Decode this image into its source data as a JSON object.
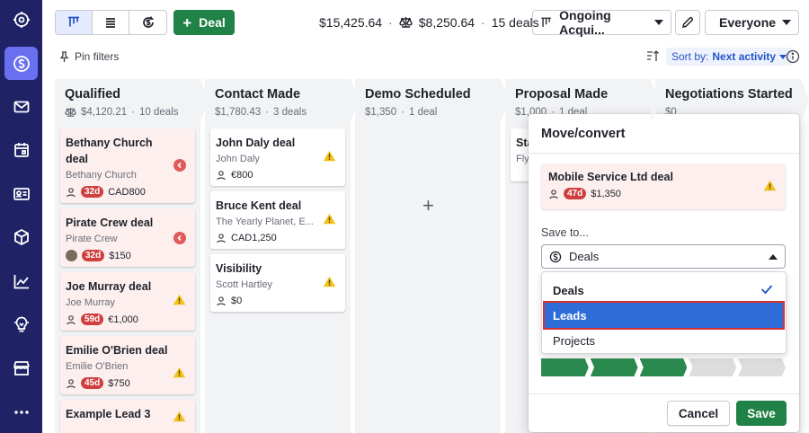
{
  "sidebar": {
    "items": [
      {
        "icon": "target-icon",
        "active": false
      },
      {
        "icon": "deals-dollar-icon",
        "active": true
      },
      {
        "icon": "mail-icon",
        "active": false
      },
      {
        "icon": "calendar-icon",
        "active": false
      },
      {
        "icon": "contacts-card-icon",
        "active": false
      },
      {
        "icon": "products-box-icon",
        "active": false
      },
      {
        "icon": "insights-chart-icon",
        "active": false
      },
      {
        "icon": "lightbulb-icon",
        "active": false
      },
      {
        "icon": "marketplace-store-icon",
        "active": false
      },
      {
        "icon": "more-dots-icon",
        "active": false
      }
    ]
  },
  "toolbar": {
    "view_buttons": [
      "kanban-view-icon",
      "list-view-icon",
      "forecast-view-icon"
    ],
    "add_deal_label": "Deal",
    "total_value": "$15,425.64",
    "weighted_value": "$8,250.64",
    "deal_count": "15 deals",
    "pipeline": "Ongoing Acqui...",
    "owner_filter": "Everyone"
  },
  "subbar": {
    "pin_filters": "Pin filters",
    "sort_prefix": "Sort by:",
    "sort_value": "Next activity"
  },
  "columns": [
    {
      "title": "Qualified",
      "weighted": true,
      "amount": "$4,120.21",
      "count": "10 deals",
      "cards": [
        {
          "title": "Bethany Church deal",
          "org": "Bethany Church",
          "days": "32d",
          "value": "CAD800",
          "rotten": true,
          "status": "overdue"
        },
        {
          "title": "Pirate Crew deal",
          "org": "Pirate Crew",
          "days": "32d",
          "value": "$150",
          "rotten": true,
          "status": "overdue",
          "avatar": true
        },
        {
          "title": "Joe Murray deal",
          "org": "Joe Murray",
          "days": "59d",
          "value": "€1,000",
          "rotten": true,
          "status": "warning"
        },
        {
          "title": "Emilie O'Brien deal",
          "org": "Emilie O'Brien",
          "days": "45d",
          "value": "$750",
          "rotten": true,
          "status": "warning"
        },
        {
          "title": "Example Lead 3",
          "org": "",
          "days": "",
          "value": "",
          "rotten": true,
          "status": "warning"
        }
      ]
    },
    {
      "title": "Contact Made",
      "weighted": false,
      "amount": "$1,780.43",
      "count": "3 deals",
      "cards": [
        {
          "title": "John Daly deal",
          "org": "John Daly",
          "days": "",
          "value": "€800",
          "rotten": false,
          "status": "warning"
        },
        {
          "title": "Bruce Kent deal",
          "org": "The Yearly Planet, E...",
          "days": "",
          "value": "CAD1,250",
          "rotten": false,
          "status": "warning"
        },
        {
          "title": "Visibility",
          "org": "Scott Hartley",
          "days": "",
          "value": "$0",
          "rotten": false,
          "status": "warning"
        }
      ]
    },
    {
      "title": "Demo Scheduled",
      "weighted": false,
      "amount": "$1,350",
      "count": "1 deal",
      "cards": []
    },
    {
      "title": "Proposal Made",
      "weighted": false,
      "amount": "$1,000",
      "count": "1 deal",
      "cards": [
        {
          "title": "Sta",
          "org": "Fly",
          "days": "",
          "value": "",
          "rotten": false,
          "status": ""
        }
      ]
    },
    {
      "title": "Negotiations Started",
      "weighted": false,
      "amount": "$0",
      "count": "",
      "cards": []
    }
  ],
  "modal": {
    "title": "Move/convert",
    "deal": {
      "title": "Mobile Service Ltd deal",
      "days": "47d",
      "value": "$1,350"
    },
    "save_to_label": "Save to...",
    "save_to_value": "Deals",
    "options": [
      {
        "label": "Deals",
        "selected": true
      },
      {
        "label": "Leads",
        "highlighted": true
      },
      {
        "label": "Projects"
      }
    ],
    "stages_done": 3,
    "stages_total": 5,
    "cancel_label": "Cancel",
    "save_label": "Save"
  },
  "colors": {
    "sidebar_bg": "#1f2265",
    "sidebar_active": "#6a6ff0",
    "primary_green": "#218247",
    "rotten_bg": "#fcefee",
    "days_badge": "#cf3f3f",
    "highlight_blue": "#2e6dd8",
    "highlight_border": "#d8322f"
  }
}
